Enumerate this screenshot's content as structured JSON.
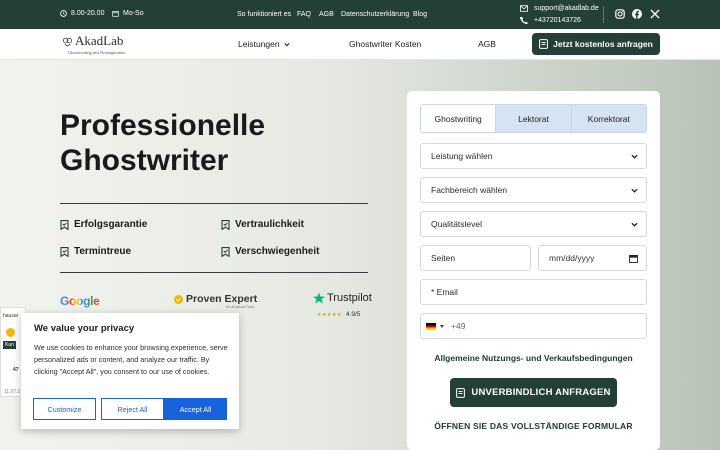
{
  "topbar": {
    "hours": "8.00-20.00",
    "days": "Mo-So",
    "links": [
      "So funktioniert es",
      "FAQ",
      "AGB",
      "Datenschutzerklärung",
      "Blog"
    ],
    "email": "support@akadlab.de",
    "phone": "+43720143726",
    "social": [
      "instagram-icon",
      "facebook-icon",
      "x-icon"
    ]
  },
  "header": {
    "logo_name": "AkadLab",
    "logo_tagline": "Ghostwriting mit Notengarantie",
    "nav": [
      "Leistungen",
      "Ghostwriter Kosten",
      "AGB"
    ],
    "cta": "Jetzt kostenlos anfragen"
  },
  "hero": {
    "title": "Professionelle Ghostwriter",
    "features": [
      "Erfolgsgarantie",
      "Vertraulichkeit",
      "Termintreue",
      "Verschwiegenheit"
    ],
    "badges": {
      "google": "Google",
      "provenexpert": "Proven Expert",
      "provenexpert_sub": "It's All About Trust",
      "trustpilot": "Trustpilot",
      "trustpilot_rating": "4.9/5"
    }
  },
  "form": {
    "tabs": [
      "Ghostwriting",
      "Lektorat",
      "Korrektorat"
    ],
    "service": "Leistung wählen",
    "field": "Fachbereich wählen",
    "level": "Qualitätslevel",
    "pages": "Seiten",
    "date": "mm/dd/yyyy",
    "email": "* Email",
    "phone_prefix": "+49",
    "terms": "Allgemeine Nutzungs- und Verkaufsbedingungen",
    "submit": "UNVERBINDLICH ANFRAGEN",
    "full_form": "ÖFFNEN SIE DAS VOLLSTÄNDIGE FORMULAR"
  },
  "widget": {
    "top": "hausar",
    "label": "Kun",
    "num": "47",
    "date": "11.07.2"
  },
  "cookie": {
    "title": "We value your privacy",
    "text": "We use cookies to enhance your browsing experience, serve personalized ads or content, and analyze our traffic. By clicking \"Accept All\", you consent to our use of cookies.",
    "customize": "Customize",
    "reject": "Reject All",
    "accept": "Accept All"
  },
  "colors": {
    "brand": "#233f37",
    "accent_blue": "#1863dc",
    "tab_inactive": "#d6e3f3"
  }
}
